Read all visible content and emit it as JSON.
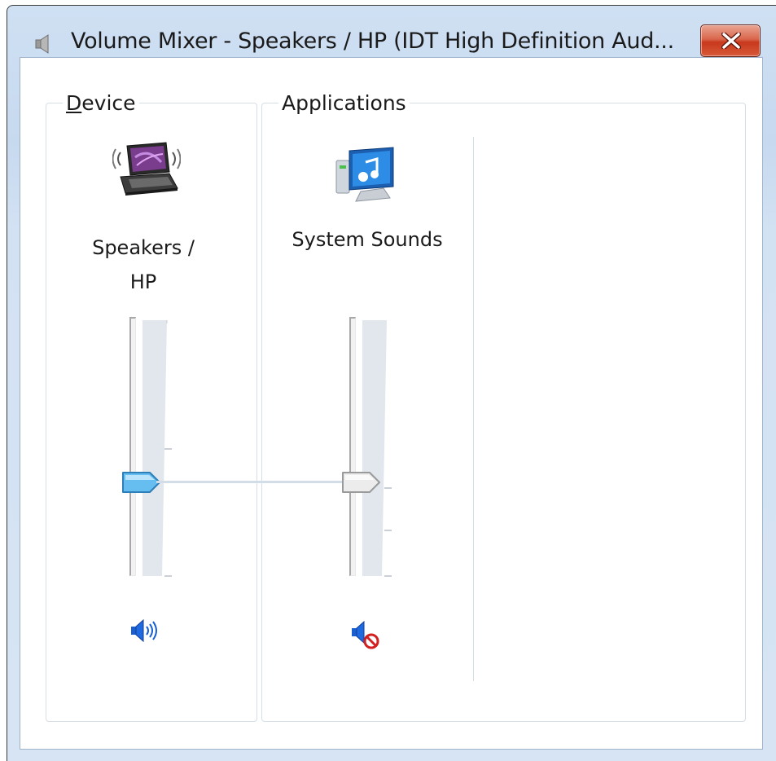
{
  "window": {
    "title": "Volume Mixer - Speakers / HP (IDT High Definition Aud...",
    "title_icon": "speaker-icon",
    "close_icon": "close-icon"
  },
  "device": {
    "group_label_accel": "D",
    "group_label_rest": "evice",
    "icon": "laptop-speakers-icon",
    "name_line1": "Speakers /",
    "name_line2": "HP",
    "volume_level_percent": 36,
    "mute_icon": "speaker-on-icon",
    "muted": false
  },
  "applications": {
    "group_label": "Applications",
    "items": [
      {
        "name": "System Sounds",
        "icon": "system-sounds-monitor-icon",
        "volume_level_percent": 36,
        "mute_icon": "speaker-muted-icon",
        "muted": true
      }
    ]
  },
  "colors": {
    "frame": "#c7d9ef",
    "close_button": "#c8381c",
    "active_thumb": "#5bb1ea",
    "inactive_thumb": "#e6e6e6",
    "mute_badge": "#d21f1f",
    "speaker_blue": "#1a5fd0"
  }
}
